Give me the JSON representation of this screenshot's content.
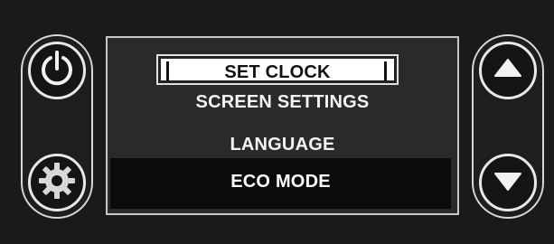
{
  "menu": {
    "items": [
      {
        "label": "SET CLOCK",
        "selected": true
      },
      {
        "label": "SCREEN SETTINGS",
        "selected": false
      },
      {
        "label": "LANGUAGE",
        "selected": false
      },
      {
        "label": "ECO MODE",
        "selected": false
      }
    ]
  },
  "buttons": {
    "left": [
      "power-icon",
      "gear-icon"
    ],
    "right": [
      "arrow-up-icon",
      "arrow-down-icon"
    ]
  },
  "colors": {
    "panel": "#1a1a1a",
    "screen": "#2a2a2a",
    "text": "#f4f4f4",
    "highlight": "#ffffff"
  }
}
